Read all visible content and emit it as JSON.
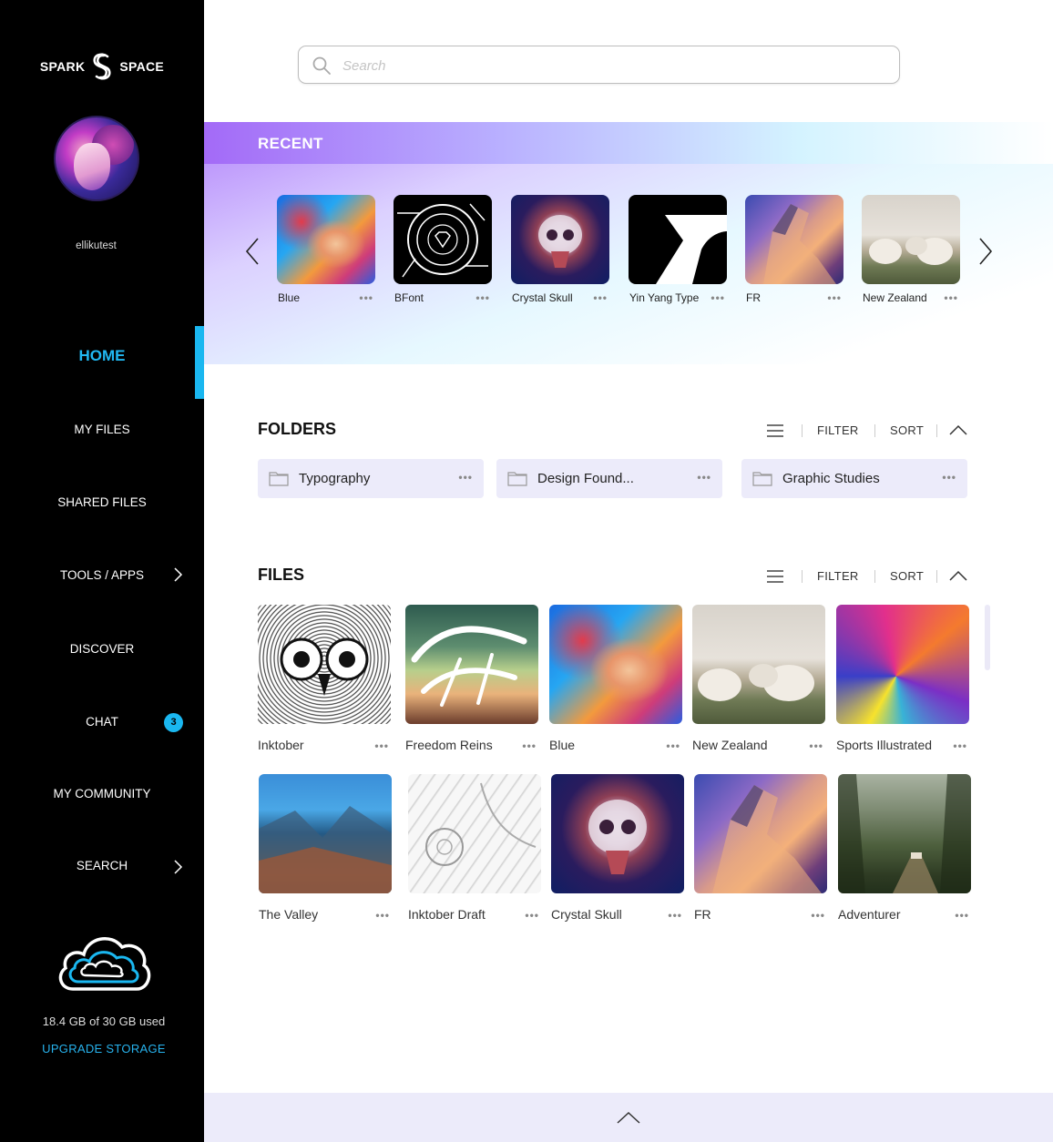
{
  "brand": {
    "left": "SPARK",
    "right": "SPACE"
  },
  "user": {
    "username": "ellikutest"
  },
  "nav": {
    "items": [
      {
        "label": "HOME",
        "active": true
      },
      {
        "label": "MY FILES"
      },
      {
        "label": "SHARED FILES"
      },
      {
        "label": "TOOLS / APPS",
        "icon": "chevron-right-icon"
      },
      {
        "label": "DISCOVER"
      },
      {
        "label": "CHAT",
        "badge": "3"
      },
      {
        "label": "MY COMMUNITY"
      },
      {
        "label": "SEARCH",
        "icon": "chevron-right-icon"
      }
    ]
  },
  "storage": {
    "usage": "18.4 GB of 30 GB used",
    "upgrade_label": "UPGRADE STORAGE",
    "icon": "cloud-icon"
  },
  "search": {
    "placeholder": "Search",
    "value": ""
  },
  "recent": {
    "title": "RECENT",
    "items": [
      {
        "label": "Blue",
        "art": "blue"
      },
      {
        "label": "BFont",
        "art": "bfont"
      },
      {
        "label": "Crystal Skull",
        "art": "skull"
      },
      {
        "label": "Yin Yang Type",
        "art": "yinyang"
      },
      {
        "label": "FR",
        "art": "horse"
      },
      {
        "label": "New Zealand",
        "art": "sheep"
      }
    ]
  },
  "folders": {
    "title": "FOLDERS",
    "filter_label": "FILTER",
    "sort_label": "SORT",
    "items": [
      {
        "name": "Typography"
      },
      {
        "name": "Design Found..."
      },
      {
        "name": "Graphic Studies"
      }
    ]
  },
  "files": {
    "title": "FILES",
    "filter_label": "FILTER",
    "sort_label": "SORT",
    "items": [
      {
        "label": "Inktober",
        "art": "owl"
      },
      {
        "label": "Freedom Reins",
        "art": "freedom"
      },
      {
        "label": "Blue",
        "art": "blue"
      },
      {
        "label": "New Zealand",
        "art": "sheep"
      },
      {
        "label": "Sports Illustrated",
        "art": "sports"
      },
      {
        "label": "The Valley",
        "art": "valley"
      },
      {
        "label": "Inktober Draft",
        "art": "draft"
      },
      {
        "label": "Crystal Skull",
        "art": "skull"
      },
      {
        "label": "FR",
        "art": "horse"
      },
      {
        "label": "Adventurer",
        "art": "adventurer"
      }
    ]
  },
  "more_dots": "•••",
  "colors": {
    "accent": "#1ab7f0",
    "sidebar_bg": "#000000",
    "folder_bg": "#ecebfa",
    "recent_gradient_start": "#a36af7"
  }
}
